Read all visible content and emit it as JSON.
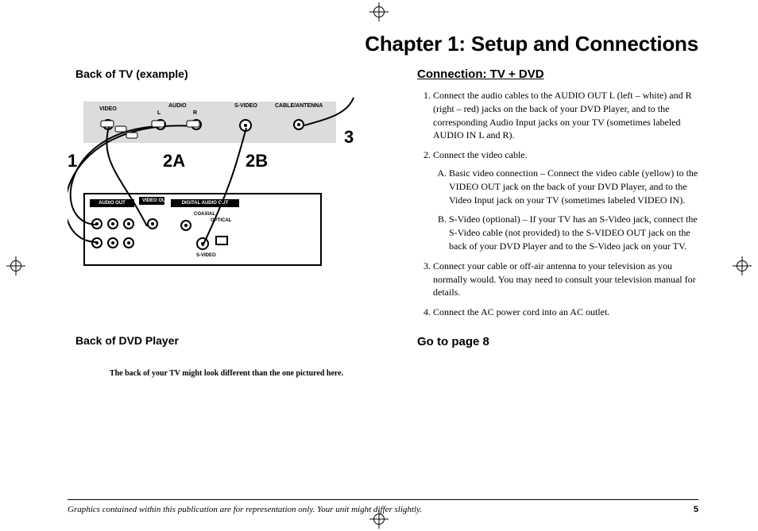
{
  "chapter_title": "Chapter 1: Setup and Connections",
  "section_title": "Connection: TV + DVD",
  "left": {
    "tv_head": "Back of TV (example)",
    "dvd_head": "Back of DVD Player",
    "caption": "The back of your TV might look different than the one pictured here.",
    "labels": {
      "video": "VIDEO",
      "audio": "AUDIO",
      "l": "L",
      "r": "R",
      "svideo": "S-VIDEO",
      "cable": "CABLE/ANTENNA",
      "audio_out": "AUDIO OUT",
      "video_out": "VIDEO OUT",
      "digital": "DIGITAL AUDIO OUT",
      "coaxial": "COAXIAL",
      "optical": "OPTICAL",
      "svideo2": "S-VIDEO"
    },
    "nums": {
      "n1": "1",
      "n2a": "2A",
      "n2b": "2B",
      "n3": "3"
    }
  },
  "steps": {
    "s1": "Connect the audio cables to the AUDIO OUT L (left – white) and R (right – red) jacks on the back of your DVD Player, and to the corresponding Audio Input jacks on your TV (sometimes labeled AUDIO IN L and R).",
    "s2": "Connect the video cable.",
    "s2a": "Basic video connection – Connect the video cable (yellow) to the VIDEO OUT jack on the back of your DVD Player, and to the Video Input jack on your TV (sometimes labeled VIDEO IN).",
    "s2b": "S-Video (optional) – If your TV has an S-Video jack, connect the S-Video cable (not provided) to the S-VIDEO OUT jack on the back of your DVD Player and to the S-Video jack on your TV.",
    "s3": "Connect your cable or off-air antenna to your television as you normally would. You may need to consult your television manual for details.",
    "s4": "Connect the AC power cord into an AC outlet."
  },
  "goto": "Go to page 8",
  "footer_text": "Graphics contained within this publication are for representation only. Your unit might differ slightly.",
  "page_number": "5"
}
